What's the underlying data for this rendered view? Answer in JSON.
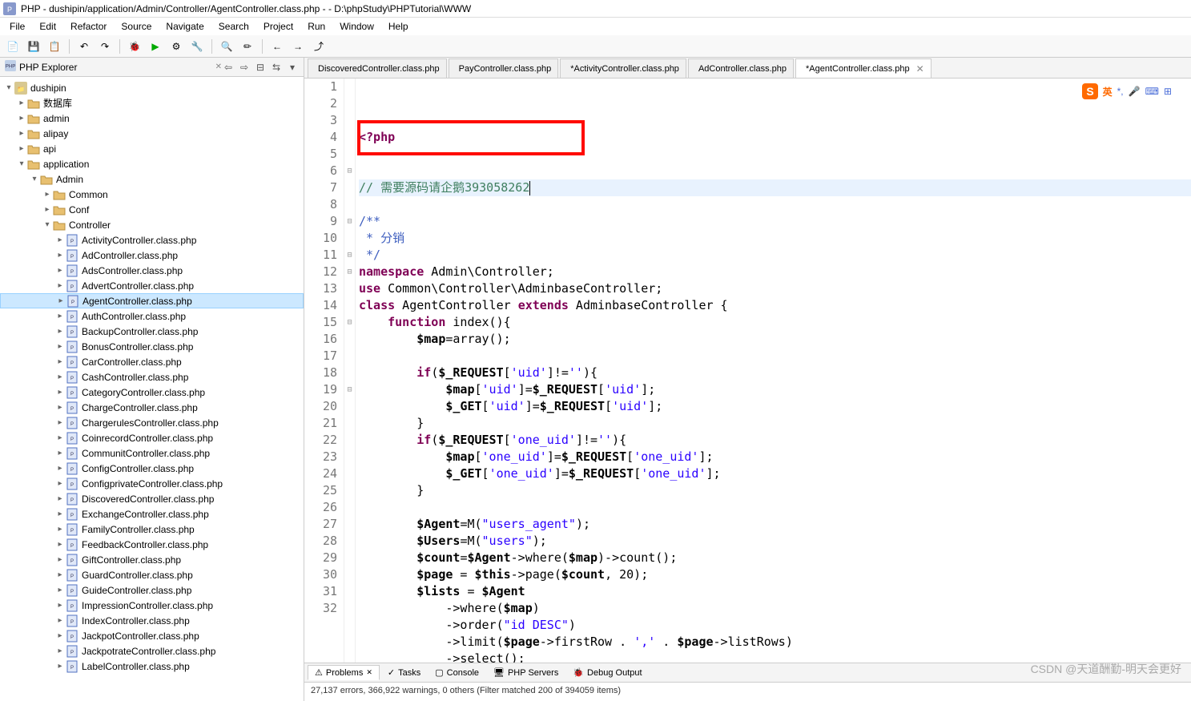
{
  "title": "PHP - dushipin/application/Admin/Controller/AgentController.class.php -  - D:\\phpStudy\\PHPTutorial\\WWW",
  "menu": [
    "File",
    "Edit",
    "Refactor",
    "Source",
    "Navigate",
    "Search",
    "Project",
    "Run",
    "Window",
    "Help"
  ],
  "explorer": {
    "title": "PHP Explorer",
    "project": "dushipin",
    "top_folders": [
      "数据库",
      "admin",
      "alipay",
      "api"
    ],
    "app_folder": "application",
    "admin_folder": "Admin",
    "admin_children": [
      "Common",
      "Conf"
    ],
    "controller_folder": "Controller",
    "controllers": [
      "ActivityController.class.php",
      "AdController.class.php",
      "AdsController.class.php",
      "AdvertController.class.php",
      "AgentController.class.php",
      "AuthController.class.php",
      "BackupController.class.php",
      "BonusController.class.php",
      "CarController.class.php",
      "CashController.class.php",
      "CategoryController.class.php",
      "ChargeController.class.php",
      "ChargerulesController.class.php",
      "CoinrecordController.class.php",
      "CommunitController.class.php",
      "ConfigController.class.php",
      "ConfigprivateController.class.php",
      "DiscoveredController.class.php",
      "ExchangeController.class.php",
      "FamilyController.class.php",
      "FeedbackController.class.php",
      "GiftController.class.php",
      "GuardController.class.php",
      "GuideController.class.php",
      "ImpressionController.class.php",
      "IndexController.class.php",
      "JackpotController.class.php",
      "JackpotrateController.class.php",
      "LabelController.class.php"
    ],
    "selected": "AgentController.class.php"
  },
  "tabs": [
    {
      "label": "DiscoveredController.class.php",
      "dirty": false
    },
    {
      "label": "PayController.class.php",
      "dirty": false
    },
    {
      "label": "*ActivityController.class.php",
      "dirty": true
    },
    {
      "label": "AdController.class.php",
      "dirty": false
    },
    {
      "label": "*AgentController.class.php",
      "dirty": true,
      "active": true
    }
  ],
  "code": {
    "lines": [
      {
        "n": 1,
        "t": "<?php",
        "cls": "kw"
      },
      {
        "n": 2,
        "t": ""
      },
      {
        "n": 3,
        "t": ""
      },
      {
        "n": 4,
        "t": "// 需要源码请企鹅393058262",
        "cls": "com",
        "hl": true,
        "cursor": true
      },
      {
        "n": 5,
        "t": ""
      },
      {
        "n": 6,
        "t": "/**",
        "cls": "doccom"
      },
      {
        "n": 7,
        "t": " * 分销",
        "cls": "doccom"
      },
      {
        "n": 8,
        "t": " */",
        "cls": "doccom"
      },
      {
        "n": 9,
        "raw": "<span class='kw'>namespace</span> Admin\\Controller;"
      },
      {
        "n": 10,
        "raw": "<span class='kw'>use</span> Common\\Controller\\AdminbaseController;"
      },
      {
        "n": 11,
        "raw": "<span class='kw'>class</span> AgentController <span class='kw'>extends</span> AdminbaseController {"
      },
      {
        "n": 12,
        "raw": "    <span class='kw'>function</span> index(){"
      },
      {
        "n": 13,
        "raw": "        <span class='var'>$map</span>=array();"
      },
      {
        "n": 14,
        "t": ""
      },
      {
        "n": 15,
        "raw": "        <span class='kw'>if</span>(<span class='var'>$_REQUEST</span>[<span class='str'>'uid'</span>]!=<span class='str'>''</span>){"
      },
      {
        "n": 16,
        "raw": "            <span class='var'>$map</span>[<span class='str'>'uid'</span>]=<span class='var'>$_REQUEST</span>[<span class='str'>'uid'</span>];"
      },
      {
        "n": 17,
        "raw": "            <span class='var'>$_GET</span>[<span class='str'>'uid'</span>]=<span class='var'>$_REQUEST</span>[<span class='str'>'uid'</span>];"
      },
      {
        "n": 18,
        "t": "        }"
      },
      {
        "n": 19,
        "raw": "        <span class='kw'>if</span>(<span class='var'>$_REQUEST</span>[<span class='str'>'one_uid'</span>]!=<span class='str'>''</span>){"
      },
      {
        "n": 20,
        "raw": "            <span class='var'>$map</span>[<span class='str'>'one_uid'</span>]=<span class='var'>$_REQUEST</span>[<span class='str'>'one_uid'</span>];"
      },
      {
        "n": 21,
        "raw": "            <span class='var'>$_GET</span>[<span class='str'>'one_uid'</span>]=<span class='var'>$_REQUEST</span>[<span class='str'>'one_uid'</span>];"
      },
      {
        "n": 22,
        "t": "        }"
      },
      {
        "n": 23,
        "t": ""
      },
      {
        "n": 24,
        "raw": "        <span class='var'>$Agent</span>=M(<span class='str'>\"users_agent\"</span>);"
      },
      {
        "n": 25,
        "raw": "        <span class='var'>$Users</span>=M(<span class='str'>\"users\"</span>);"
      },
      {
        "n": 26,
        "raw": "        <span class='var'>$count</span>=<span class='var'>$Agent</span>->where(<span class='var'>$map</span>)->count();"
      },
      {
        "n": 27,
        "raw": "        <span class='var'>$page</span> = <span class='var'>$this</span>->page(<span class='var'>$count</span>, 20);"
      },
      {
        "n": 28,
        "raw": "        <span class='var'>$lists</span> = <span class='var'>$Agent</span>"
      },
      {
        "n": 29,
        "raw": "            ->where(<span class='var'>$map</span>)"
      },
      {
        "n": 30,
        "raw": "            ->order(<span class='str'>\"id DESC\"</span>)"
      },
      {
        "n": 31,
        "raw": "            ->limit(<span class='var'>$page</span>->firstRow . <span class='str'>','</span> . <span class='var'>$page</span>->listRows)"
      },
      {
        "n": 32,
        "raw": "            ->select();"
      }
    ]
  },
  "bottom": {
    "tabs": [
      "Problems",
      "Tasks",
      "Console",
      "PHP Servers",
      "Debug Output"
    ],
    "active": "Problems",
    "status": "27,137 errors, 366,922 warnings, 0 others (Filter matched 200 of 394059 items)"
  },
  "ime": {
    "label": "英",
    "punct": "*,"
  },
  "watermark": "CSDN @天道酬勤-明天会更好"
}
